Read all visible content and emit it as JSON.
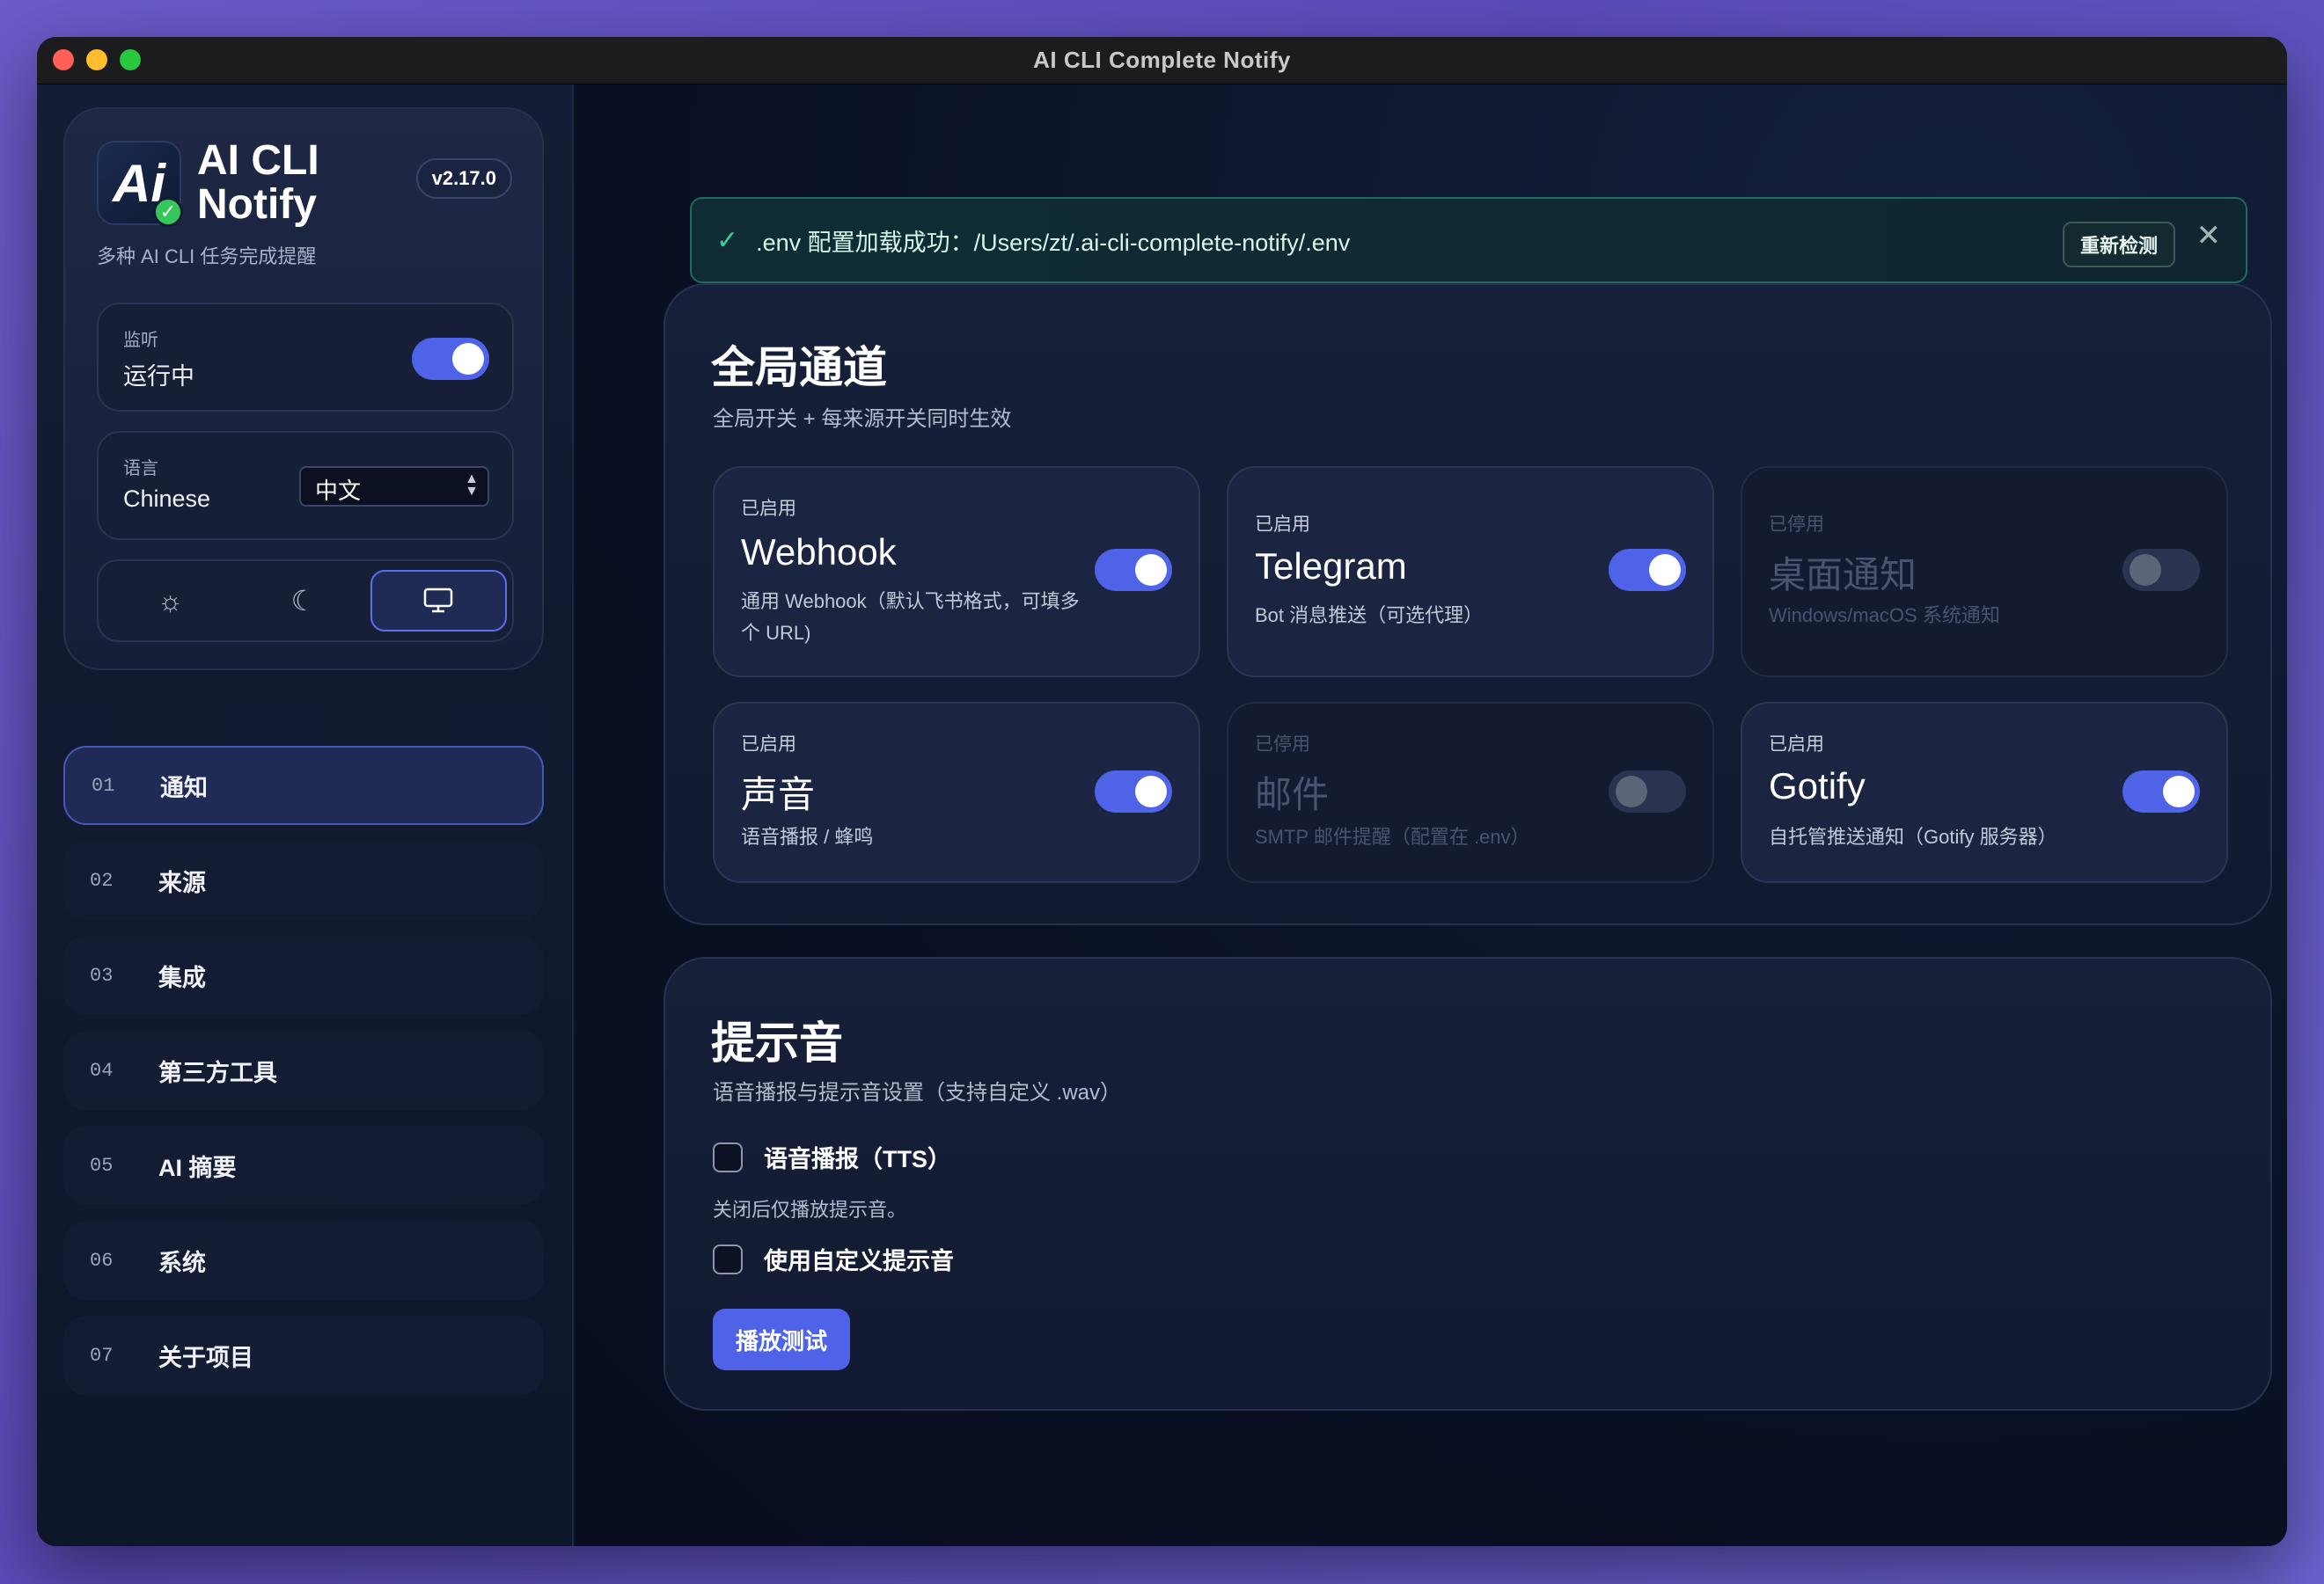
{
  "window": {
    "title": "AI CLI Complete Notify"
  },
  "sidebar": {
    "logo_text": "Ai",
    "brand_name": "AI CLI Notify",
    "version": "v2.17.0",
    "subtitle": "多种 AI CLI 任务完成提醒",
    "monitor": {
      "label": "监听",
      "value": "运行中",
      "enabled": true
    },
    "language": {
      "label": "语言",
      "value": "Chinese",
      "selected": "中文"
    },
    "theme": {
      "options": [
        "light",
        "dark",
        "system"
      ],
      "active": "system"
    },
    "nav": [
      {
        "num": "01",
        "label": "通知",
        "active": true
      },
      {
        "num": "02",
        "label": "来源",
        "active": false
      },
      {
        "num": "03",
        "label": "集成",
        "active": false
      },
      {
        "num": "04",
        "label": "第三方工具",
        "active": false
      },
      {
        "num": "05",
        "label": "AI 摘要",
        "active": false
      },
      {
        "num": "06",
        "label": "系统",
        "active": false
      },
      {
        "num": "07",
        "label": "关于项目",
        "active": false
      }
    ]
  },
  "banner": {
    "text": ".env 配置加载成功：/Users/zt/.ai-cli-complete-notify/.env",
    "recheck_label": "重新检测",
    "close_symbol": "✕"
  },
  "global_channels": {
    "title": "全局通道",
    "subtitle": "全局开关 + 每来源开关同时生效",
    "channels": [
      {
        "status": "已启用",
        "name": "Webhook",
        "desc": "通用 Webhook（默认飞书格式，可填多个 URL)",
        "enabled": true
      },
      {
        "status": "已启用",
        "name": "Telegram",
        "desc": "Bot 消息推送（可选代理）",
        "enabled": true
      },
      {
        "status": "已停用",
        "name": "桌面通知",
        "desc": "Windows/macOS 系统通知",
        "enabled": false
      },
      {
        "status": "已启用",
        "name": "声音",
        "desc": "语音播报 / 蜂鸣",
        "enabled": true
      },
      {
        "status": "已停用",
        "name": "邮件",
        "desc": "SMTP 邮件提醒（配置在 .env）",
        "enabled": false
      },
      {
        "status": "已启用",
        "name": "Gotify",
        "desc": "自托管推送通知（Gotify 服务器）",
        "enabled": true
      }
    ]
  },
  "sound": {
    "title": "提示音",
    "subtitle": "语音播报与提示音设置（支持自定义 .wav）",
    "tts_label": "语音播报（TTS）",
    "tts_checked": false,
    "tts_hint": "关闭后仅播放提示音。",
    "custom_label": "使用自定义提示音",
    "custom_checked": false,
    "play_button": "播放测试"
  },
  "colors": {
    "accent": "#4f63e8",
    "success": "#34d399",
    "background": "#0b1326"
  }
}
